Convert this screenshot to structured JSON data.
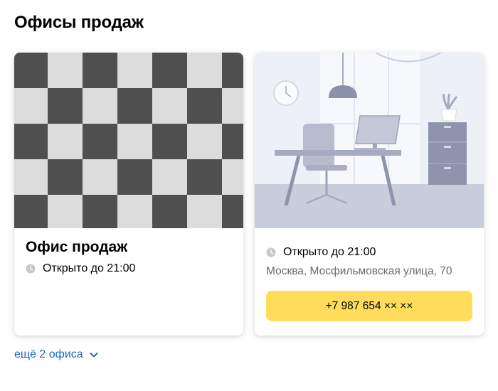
{
  "section": {
    "title": "Офисы продаж"
  },
  "offices": [
    {
      "title": "Офис продаж",
      "hours": "Открыто до 21:00",
      "image": "placeholder-checkerboard"
    },
    {
      "hours": "Открыто до 21:00",
      "address": "Москва, Мосфильмовская улица, 70",
      "phone": "+7 987 654 ×× ××",
      "image": "office-interior-illustration"
    }
  ],
  "more": {
    "label": "ещё 2 офиса",
    "icon": "chevron-down-icon"
  },
  "colors": {
    "accent_button": "#ffdc5b",
    "link": "#1e66c9",
    "muted_text": "#6b6b6b"
  }
}
